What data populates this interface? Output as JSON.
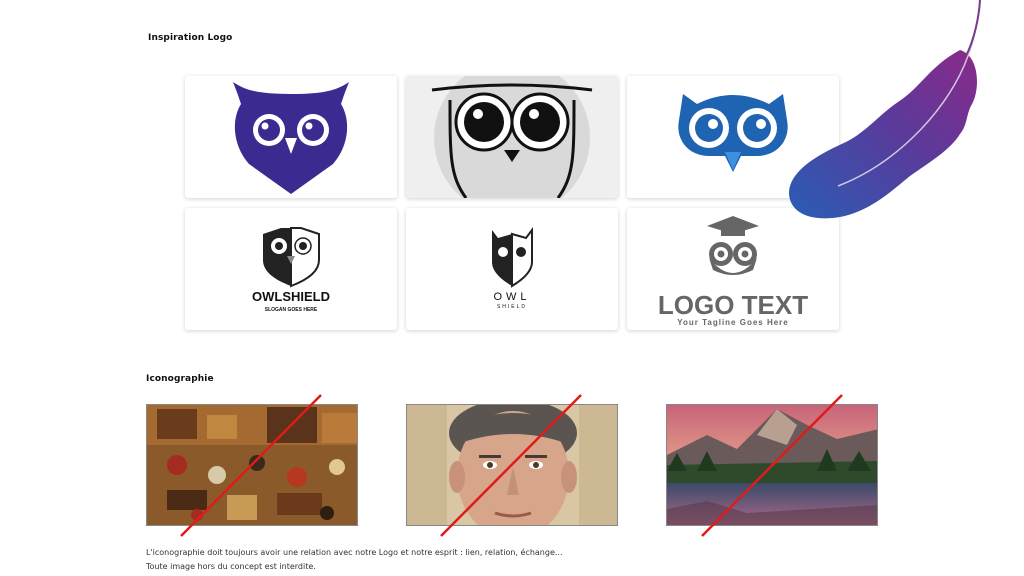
{
  "sections": {
    "inspiration": {
      "title": "Inspiration Logo"
    },
    "iconography": {
      "title": "Iconographie"
    }
  },
  "logos": [
    {
      "icon": "purple-heart-owl-icon",
      "color": "#3b2a8f"
    },
    {
      "icon": "grey-round-owl-icon",
      "color": "#d6d6d6"
    },
    {
      "icon": "blue-owl-icon",
      "color": "#1f63b3"
    },
    {
      "icon": "owlshield-icon",
      "name": "OWLSHIELD",
      "slogan": "SLOGAN GOES HERE"
    },
    {
      "icon": "owl-shield-minimal-icon",
      "name": "OWL",
      "sub": "SHIELD"
    },
    {
      "icon": "graduate-owl-icon",
      "name": "LOGO TEXT",
      "tagline": "Your Tagline Goes Here"
    }
  ],
  "photos": [
    {
      "icon": "medieval-painting-image"
    },
    {
      "icon": "man-portrait-image"
    },
    {
      "icon": "mountain-lake-image"
    }
  ],
  "note": {
    "line1": "L'iconographie doit toujours avoir une relation avec notre Logo et notre esprit : lien, relation, échange...",
    "line2": "Toute image hors du concept est interdite."
  },
  "decor": {
    "feather": "feather-icon",
    "slash_color": "#e01b1b"
  }
}
